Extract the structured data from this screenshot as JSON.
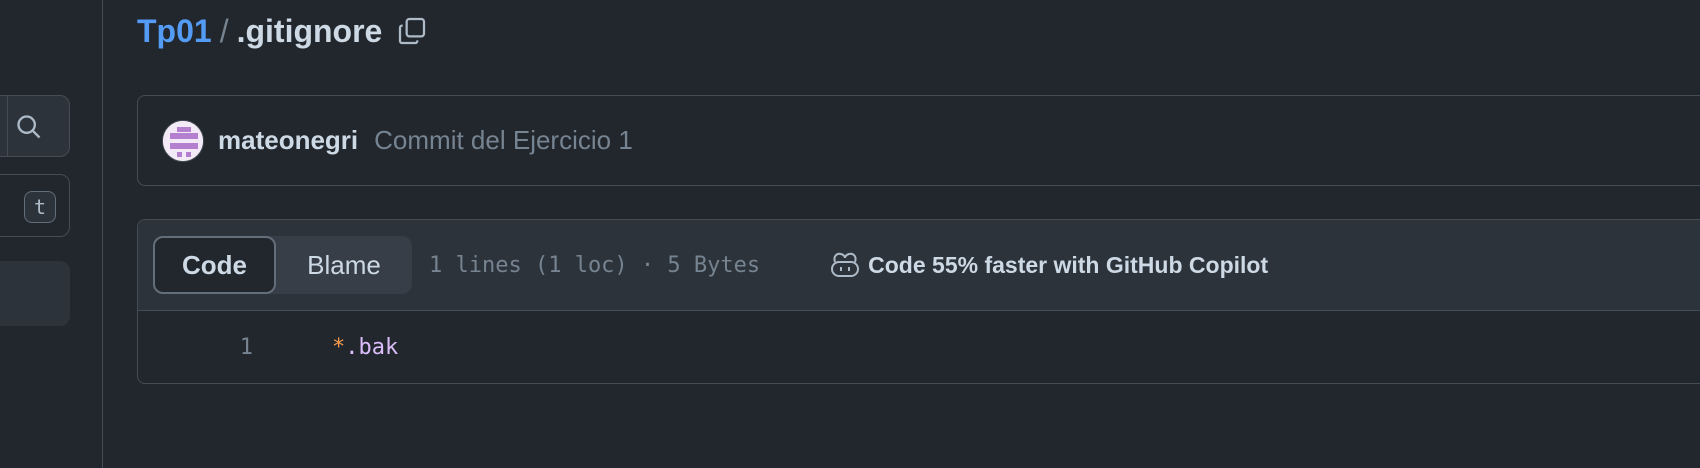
{
  "sidebar": {
    "search_icon": "search-icon",
    "goto_shortcut": "t"
  },
  "breadcrumb": {
    "repo": "Tp01",
    "separator": "/",
    "file": ".gitignore",
    "copy_icon": "copy-icon"
  },
  "commit": {
    "author": "mateonegri",
    "message": "Commit del Ejercicio 1"
  },
  "file": {
    "tabs": [
      {
        "label": "Code",
        "active": true
      },
      {
        "label": "Blame",
        "active": false
      }
    ],
    "meta": "1 lines (1 loc) · 5 Bytes",
    "copilot_label": "Code 55% faster with GitHub Copilot",
    "lines": [
      {
        "number": "1",
        "op": "*",
        "rest": ".bak"
      }
    ]
  },
  "colors": {
    "background": "#22272e",
    "panel": "#2d333b",
    "border": "#444c56",
    "link": "#539bf5",
    "muted": "#768390",
    "text": "#cdd9e5",
    "code_operator": "#f69d50",
    "code_string": "#dcbdfb"
  }
}
